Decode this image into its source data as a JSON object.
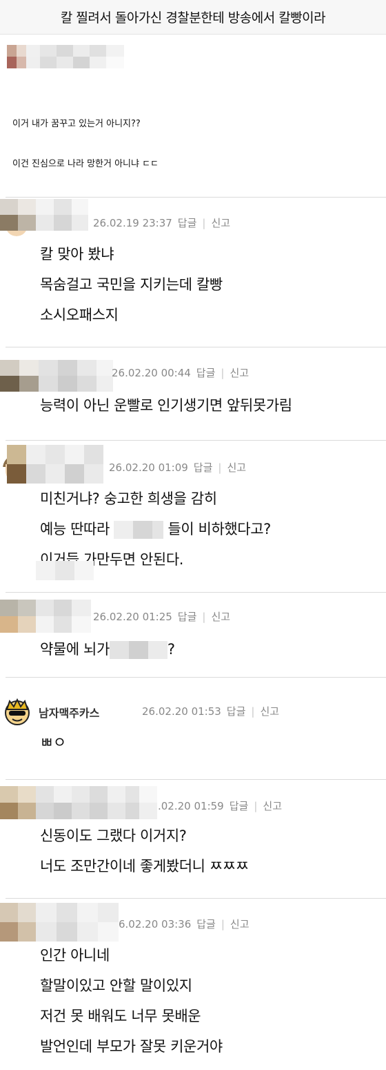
{
  "post": {
    "title": "칼 찔려서 돌아가신 경찰분한테 방송에서 칼빵이라",
    "body": [
      "이거 내가 꿈꾸고 있는거 아니지??",
      "이건 진심으로 나라 망한거 아니냐 ㄷㄷ"
    ]
  },
  "actions": {
    "reply": "답글",
    "separator": "|",
    "report": "신고"
  },
  "comments": [
    {
      "time": "26.02.19 23:37",
      "lines": [
        "칼 맞아 봤냐",
        "목숨걸고 국민을 지키는데 칼빵",
        "소시오패스지"
      ]
    },
    {
      "time": "26.02.20 00:44",
      "lines": [
        "능력이 아닌 운빨로 인기생기면 앞뒤못가림"
      ]
    },
    {
      "time": "26.02.20 01:09",
      "lines": [
        "미친거냐? 숭고한 희생을 감히",
        "예능 딴따라",
        "들이 비하했다고?",
        "이거듭 가만두면 안된다."
      ]
    },
    {
      "time": "26.02.20 01:25",
      "lines": [
        "약물에 뇌가",
        "?"
      ]
    },
    {
      "nickname": "남자맥주카스",
      "time": "26.02.20 01:53",
      "lines": [
        "ㅃㅇ"
      ]
    },
    {
      "time": ".02.20 01:59",
      "lines": [
        "신동이도 그랬다 이거지?",
        "너도 조만간이네 좋게봤더니 ㅉㅉㅉ"
      ]
    },
    {
      "time": "6.02.20 03:36",
      "lines": [
        "인간 아니네",
        "할말이있고 안할 말이있지",
        "저건 못 배워도 너무 못배운",
        "발언인데 부모가 잘못 키운거야"
      ]
    }
  ],
  "icons": {
    "avatar": "cartoon-avatar-icon",
    "blur": "pixelated-mosaic",
    "beer_avatar": "beer-cartoon-avatar-icon"
  },
  "colors": {
    "title_bg": "#f7f7f7",
    "meta_text": "#888888",
    "divider": "#dadada"
  }
}
